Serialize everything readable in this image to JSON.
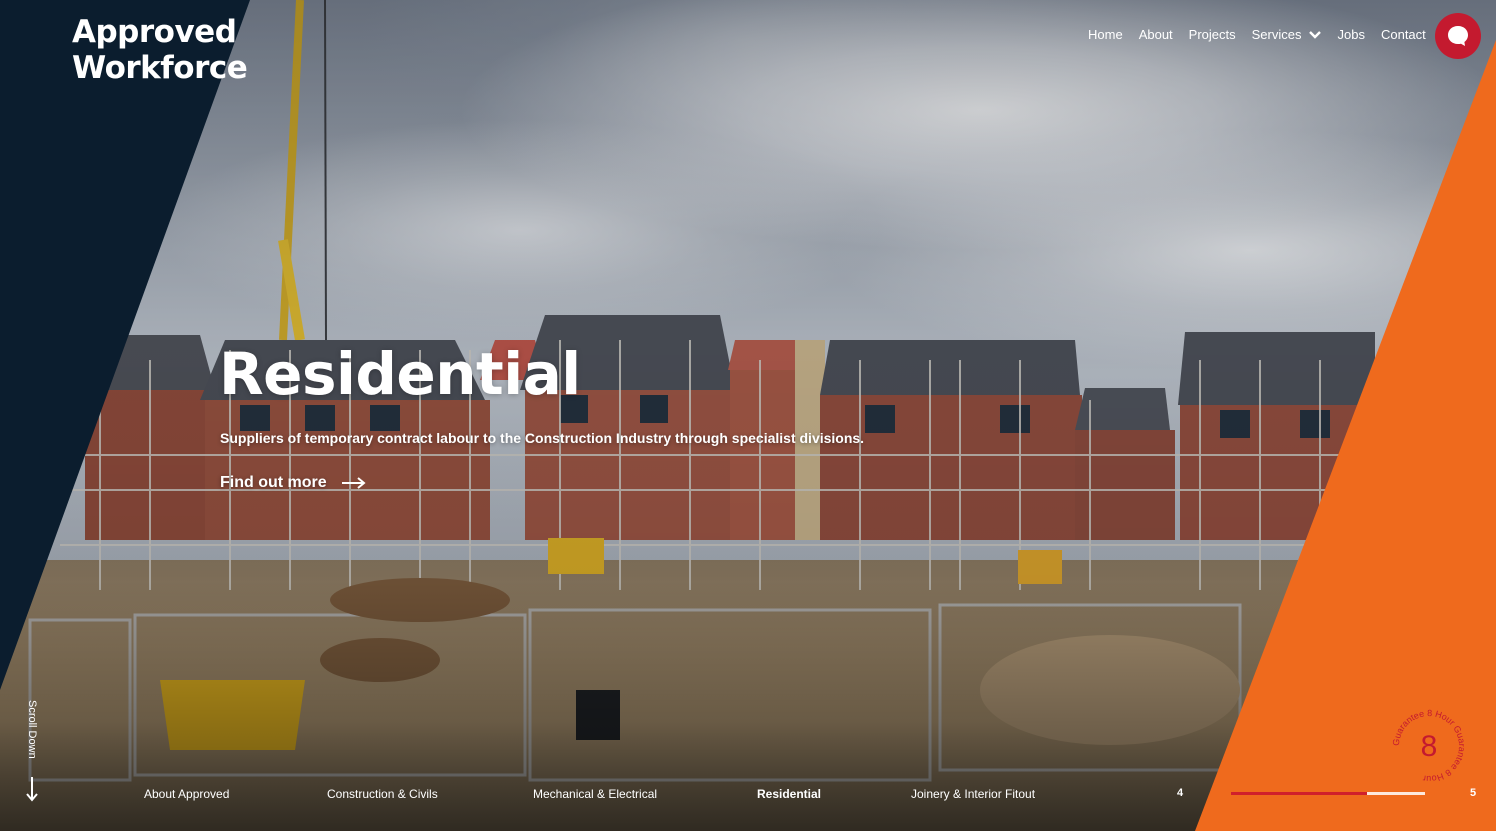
{
  "brand": {
    "line1": "Approved",
    "line2": "Workforce",
    "navy": "#0b1d2e",
    "orange": "#ef6a1d",
    "red": "#c41a2f"
  },
  "nav": {
    "home": "Home",
    "about": "About",
    "projects": "Projects",
    "services": "Services",
    "jobs": "Jobs",
    "contact": "Contact"
  },
  "hero": {
    "title": "Residential",
    "subtitle": "Suppliers of temporary contract labour to the Construction Industry through specialist divisions.",
    "cta": "Find out more"
  },
  "scroll": {
    "label": "Scroll Down"
  },
  "slides": {
    "items": [
      "About Approved",
      "Construction & Civils",
      "Mechanical & Electrical",
      "Residential",
      "Joinery & Interior Fitout"
    ],
    "active_index": 3,
    "current": "4",
    "total": "5",
    "progress_fraction": 0.7
  },
  "badge": {
    "number": "8",
    "ring_text": "Guarantee 8 Hour Guarantee 8 Hour "
  },
  "icons": [
    "chevron-down-icon",
    "chat-bubble-icon",
    "arrow-right-icon",
    "arrow-down-icon"
  ]
}
